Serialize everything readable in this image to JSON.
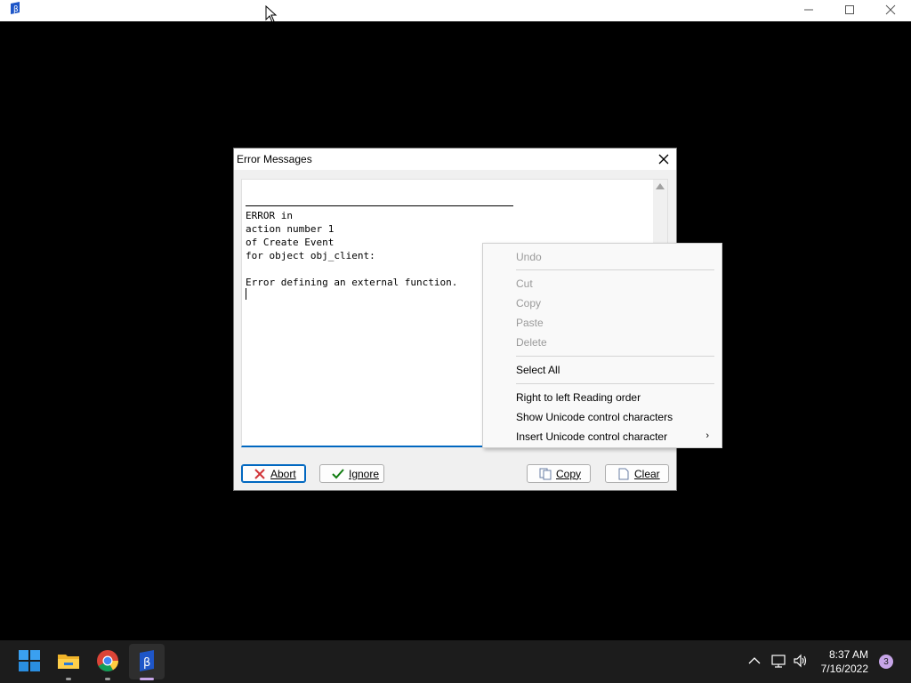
{
  "dialog": {
    "title": "Error Messages",
    "message_lines": "ERROR in\naction number 1\nof Create Event\nfor object obj_client:\n\nError defining an external function.",
    "buttons": {
      "abort": "Abort",
      "ignore": "Ignore",
      "copy": "Copy",
      "clear": "Clear"
    }
  },
  "context_menu": {
    "items": [
      {
        "label": "Undo",
        "enabled": false
      },
      {
        "label": "Cut",
        "enabled": false
      },
      {
        "label": "Copy",
        "enabled": false
      },
      {
        "label": "Paste",
        "enabled": false
      },
      {
        "label": "Delete",
        "enabled": false
      },
      {
        "label": "Select All",
        "enabled": true
      },
      {
        "label": "Right to left Reading order",
        "enabled": true
      },
      {
        "label": "Show Unicode control characters",
        "enabled": true
      },
      {
        "label": "Insert Unicode control character",
        "enabled": true,
        "submenu": true
      }
    ]
  },
  "taskbar": {
    "time": "8:37 AM",
    "date": "7/16/2022",
    "notification_count": "3",
    "apps": [
      "windows-start-icon",
      "file-explorer-icon",
      "chrome-icon",
      "gamemaker-icon"
    ]
  },
  "colors": {
    "accent": "#0067c0",
    "abort_icon": "#d13438",
    "ignore_icon": "#107c10",
    "taskbar": "#1c1c1c"
  }
}
